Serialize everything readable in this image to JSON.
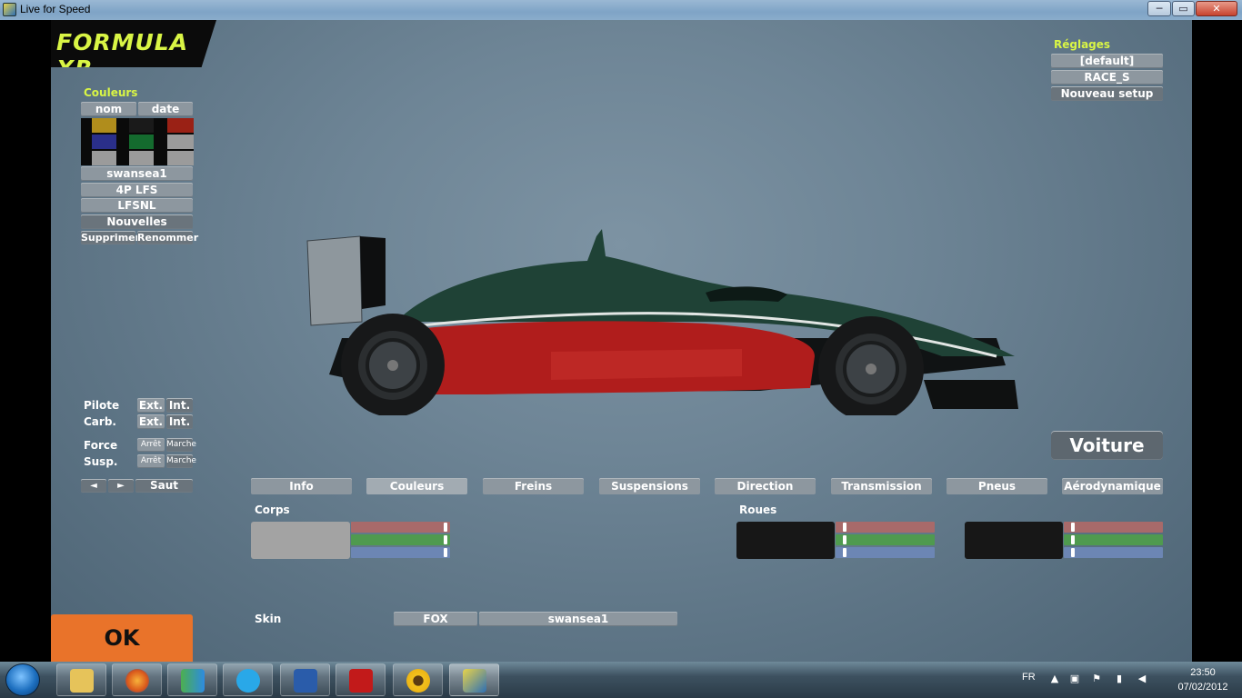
{
  "window": {
    "title": "Live for Speed",
    "minimize_glyph": "─",
    "maximize_glyph": "▭",
    "close_glyph": "✕"
  },
  "car": {
    "name": "FORMULA XR"
  },
  "colours_panel": {
    "title": "Couleurs",
    "sort_name": "nom",
    "sort_date": "date",
    "swatch_colors": [
      "#b08d1c",
      "#1a1a1a",
      "#9a2115",
      "#2a2f8a",
      "#146b2e",
      "#9b9b9b",
      "#9b9b9b",
      "#9b9b9b",
      "#9b9b9b"
    ],
    "schemes": [
      "swansea1",
      "4P LFS",
      "LFSNL"
    ],
    "new_colours": "Nouvelles couleurs",
    "delete": "Supprimer",
    "rename": "Renommer"
  },
  "setups_panel": {
    "title": "Réglages",
    "items": [
      "[default]",
      "RACE_S"
    ],
    "new_setup": "Nouveau setup"
  },
  "view_controls": {
    "driver_label": "Pilote",
    "fuel_label": "Carb.",
    "ext": "Ext.",
    "int": "Int.",
    "force_label": "Force",
    "susp_label": "Susp.",
    "off": "Arrêt",
    "on": "Marche",
    "prev": "◄",
    "next": "►",
    "jump": "Saut"
  },
  "car_button": "Voiture",
  "tabs": [
    "Info",
    "Couleurs",
    "Freins",
    "Suspensions",
    "Direction",
    "Transmission",
    "Pneus",
    "Aérodynamique"
  ],
  "active_tab": "Couleurs",
  "body_colour": {
    "label": "Corps",
    "swatch": "#a3a3a3",
    "rgb": [
      1.0,
      1.0,
      1.0
    ]
  },
  "wheel_colour": {
    "label": "Roues",
    "swatch_1": "#171717",
    "swatch_2": "#171717",
    "rgb_1": [
      0.0,
      0.0,
      0.0
    ],
    "rgb_2": [
      0.0,
      0.0,
      0.0
    ]
  },
  "slider_colors": {
    "red": "#a86a6a",
    "green": "#4f9a4f",
    "blue": "#6c86b4"
  },
  "skin": {
    "label": "Skin",
    "car_code": "FOX",
    "name": "swansea1"
  },
  "ok_button": "OK",
  "taskbar": {
    "language": "FR",
    "time": "23:50",
    "date": "07/02/2012",
    "apps": [
      "file-explorer",
      "firefox",
      "messenger",
      "skype",
      "word",
      "acrobat-reader",
      "sunflower-app",
      "live-for-speed"
    ],
    "tray_icons": [
      "show-hidden-icons",
      "network-icon",
      "flag-icon",
      "signal-icon",
      "volume-icon"
    ]
  }
}
